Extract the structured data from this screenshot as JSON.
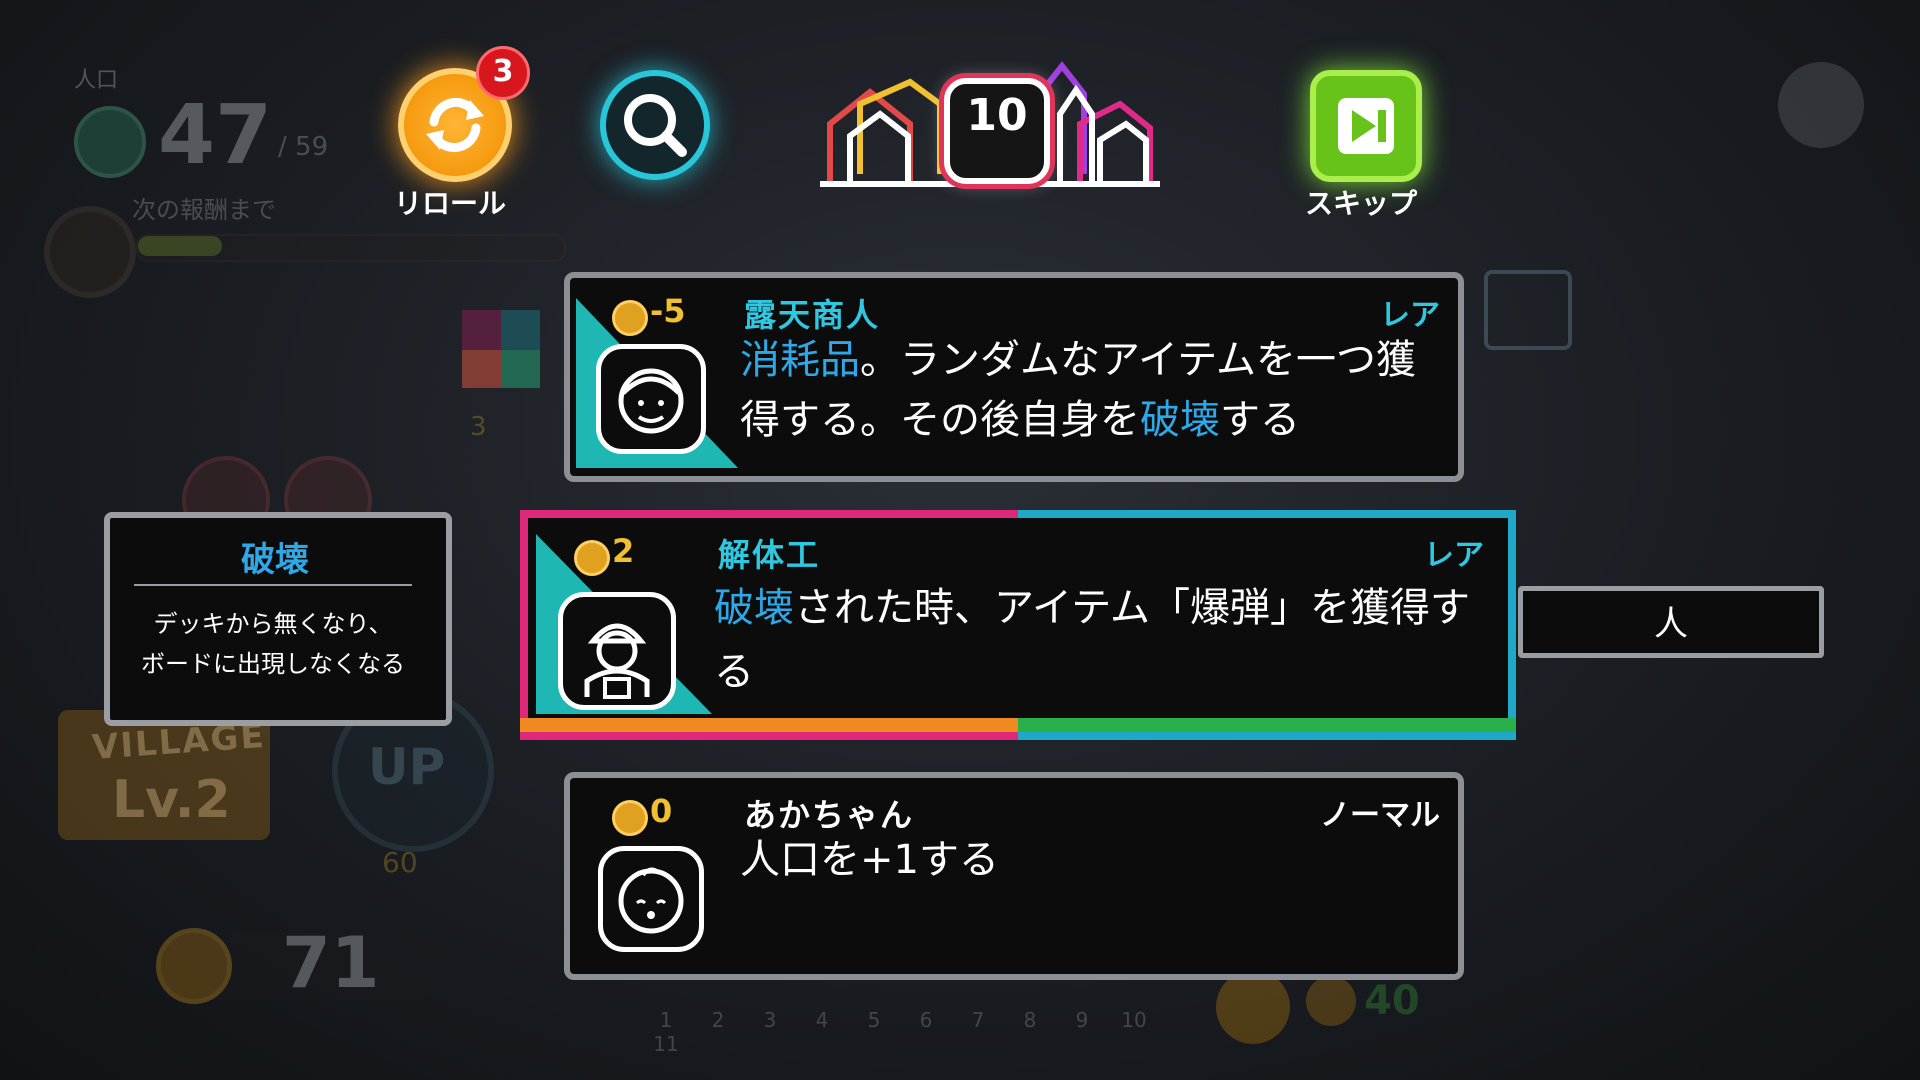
{
  "hud": {
    "population_label": "人口",
    "population": "47",
    "population_max": "/ 59",
    "next_reward_label": "次の報酬まで",
    "village_label": "VILLAGE",
    "village_level": "Lv.2",
    "up_label": "UP",
    "up_cost": "60",
    "coins": "71",
    "right_coins": "40",
    "pager": [
      "1",
      "2",
      "3",
      "4",
      "5",
      "6",
      "7",
      "8",
      "9",
      "10",
      "11"
    ],
    "side_coin_count": "3",
    "accent_colors": {
      "reroll": "#f59a0e",
      "search": "#27c6d8",
      "skip": "#67c21a",
      "rare": "#2fc8e0"
    }
  },
  "top": {
    "reroll_label": "リロール",
    "reroll_badge": "3",
    "turn": "10",
    "skip_label": "スキップ",
    "icons": {
      "reroll": "refresh-icon",
      "search": "search-icon",
      "skip": "skip-icon",
      "settings": "gear-icon"
    }
  },
  "cards": [
    {
      "cost": "-5",
      "name": "露天商人",
      "rarity": "レア",
      "desc": [
        {
          "t": "消耗品",
          "kw": true
        },
        {
          "t": "。ランダムなアイテムを一つ獲",
          "kw": false
        },
        {
          "t": "得する。その後自身を",
          "kw": false
        },
        {
          "t": "破壊",
          "kw": true
        },
        {
          "t": "する",
          "kw": false
        }
      ],
      "icon": "merchant-icon"
    },
    {
      "cost": "2",
      "name": "解体工",
      "rarity": "レア",
      "desc": [
        {
          "t": "破壊",
          "kw": true
        },
        {
          "t": "された時、アイテム「爆弾」を獲",
          "kw": false
        },
        {
          "t": "得する",
          "kw": false
        }
      ],
      "icon": "worker-icon"
    },
    {
      "cost": "0",
      "name": "あかちゃん",
      "rarity": "ノーマル",
      "desc": [
        {
          "t": "人口を+1する",
          "kw": false
        }
      ],
      "icon": "baby-icon"
    }
  ],
  "tooltip": {
    "title": "破壊",
    "line1": "デッキから無くなり、",
    "line2": "ボードに出現しなくなる"
  },
  "tag": {
    "label": "人"
  }
}
